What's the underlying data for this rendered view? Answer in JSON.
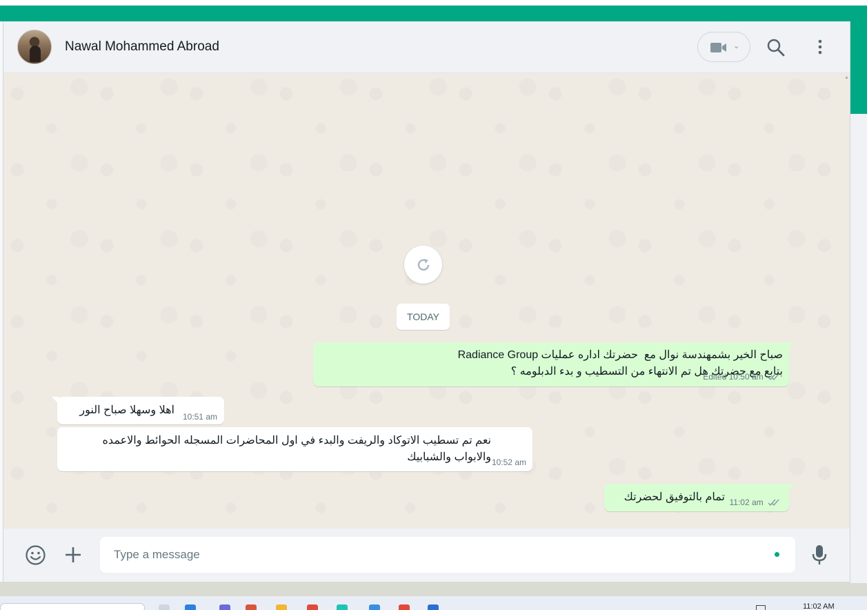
{
  "chat": {
    "contact_name": "Nawal Mohammed Abroad"
  },
  "header": {
    "video_icon": "video-camera-icon",
    "search_icon": "search-icon",
    "menu_icon": "vertical-dots-menu-icon"
  },
  "conversation": {
    "date_separator": "TODAY",
    "reload_icon": "refresh-icon",
    "messages": [
      {
        "direction": "outgoing",
        "text": "صباح الخير بشمهندسة نوال مع  حضرتك اداره عمليات Radiance Group\nبتابع مع حضرتك هل تم الانتهاء من التسطيب و بدء الدبلومه ؟",
        "status": "Edited",
        "time": "10:50 am",
        "read_receipt": "double-check-icon"
      },
      {
        "direction": "incoming",
        "text": "اهلا وسهلا صباح النور",
        "time": "10:51 am"
      },
      {
        "direction": "incoming",
        "text": "نعم تم تسطيب الاتوكاد والريفت والبدء في اول المحاضرات المسجله الحوائط والاعمده\nوالابواب والشبابيك",
        "time": "10:52 am"
      },
      {
        "direction": "outgoing",
        "text": "تمام بالتوفيق لحضرتك",
        "time": "11:02 am",
        "read_receipt": "double-check-icon"
      }
    ]
  },
  "composer": {
    "placeholder": "Type a message",
    "emoji_icon": "emoji-icon",
    "attach_icon": "plus-icon",
    "mic_icon": "microphone-icon"
  },
  "taskbar": {
    "clock": "11:02 AM"
  },
  "colors": {
    "accent": "#00a884",
    "outgoing_bubble": "#d9fdd3",
    "incoming_bubble": "#ffffff",
    "chat_background": "#efeae2",
    "panel": "#f0f2f5"
  }
}
